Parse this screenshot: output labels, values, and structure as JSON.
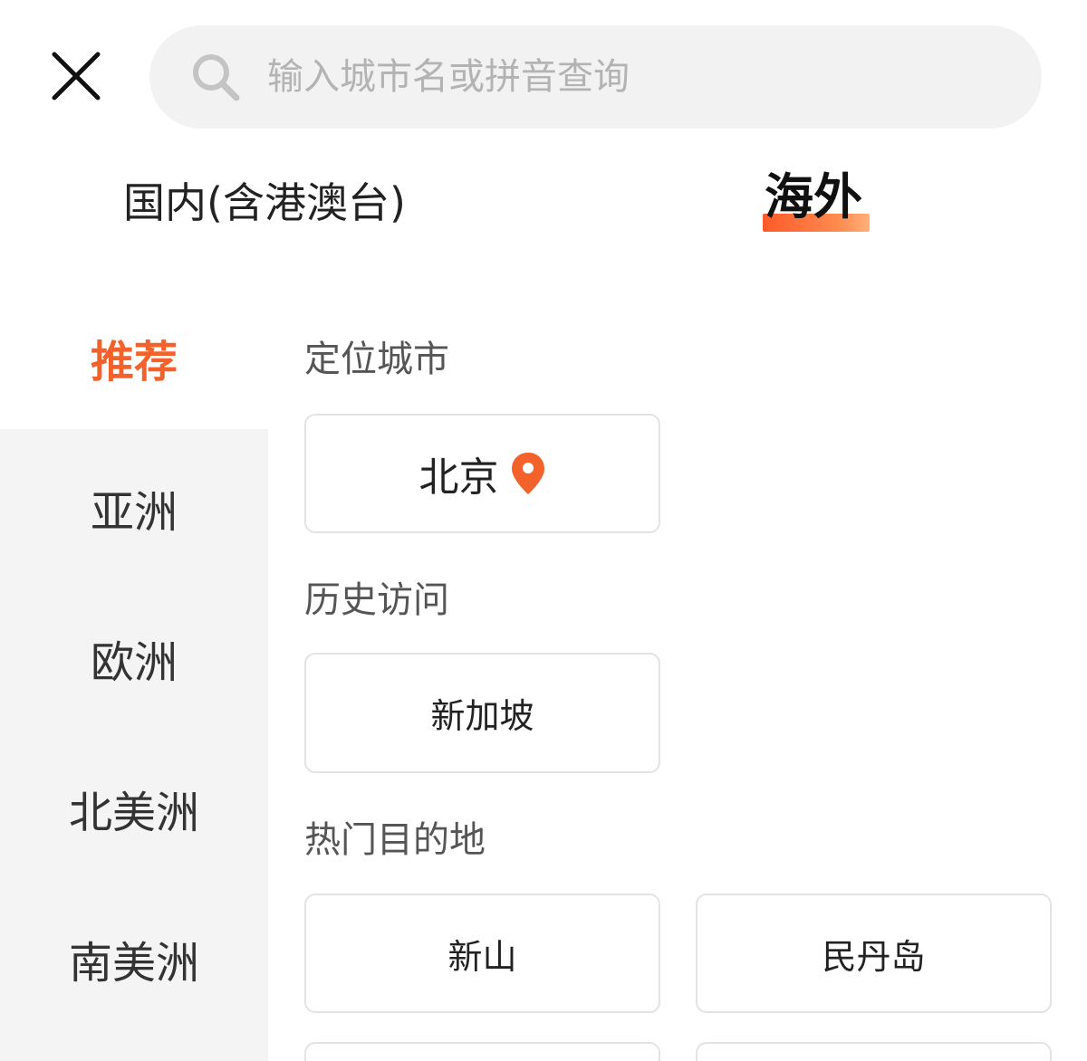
{
  "search": {
    "placeholder": "输入城市名或拼音查询",
    "value": ""
  },
  "icons": {
    "close": "close-icon",
    "search": "search-icon",
    "location": "location-pin-icon"
  },
  "tabs": {
    "domestic": "国内(含港澳台)",
    "overseas": "海外",
    "selected": "overseas"
  },
  "colors": {
    "accent": "#f2622a",
    "left_panel_bg": "#f4f4f4",
    "search_bg": "#f2f2f2"
  },
  "categories": [
    {
      "label": "推荐",
      "active": true
    },
    {
      "label": "亚洲",
      "active": false
    },
    {
      "label": "欧洲",
      "active": false
    },
    {
      "label": "北美洲",
      "active": false
    },
    {
      "label": "南美洲",
      "active": false
    }
  ],
  "sections": {
    "located": {
      "title": "定位城市",
      "city": "北京"
    },
    "history": {
      "title": "历史访问",
      "cities": [
        "新加坡"
      ]
    },
    "hot": {
      "title": "热门目的地",
      "cities": [
        "新山",
        "民丹岛"
      ]
    }
  }
}
